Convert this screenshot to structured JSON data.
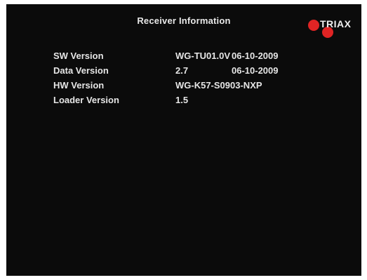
{
  "title": "Receiver Information",
  "logo": {
    "text": "TRIAX",
    "color": "#e02424"
  },
  "rows": [
    {
      "label": "SW Version",
      "value": "WG-TU01.0V",
      "date": "06-10-2009"
    },
    {
      "label": "Data Version",
      "value": "2.7",
      "date": "06-10-2009"
    },
    {
      "label": "HW Version",
      "value": "WG-K57-S0903-NXP",
      "date": ""
    },
    {
      "label": "Loader Version",
      "value": "1.5",
      "date": ""
    }
  ]
}
